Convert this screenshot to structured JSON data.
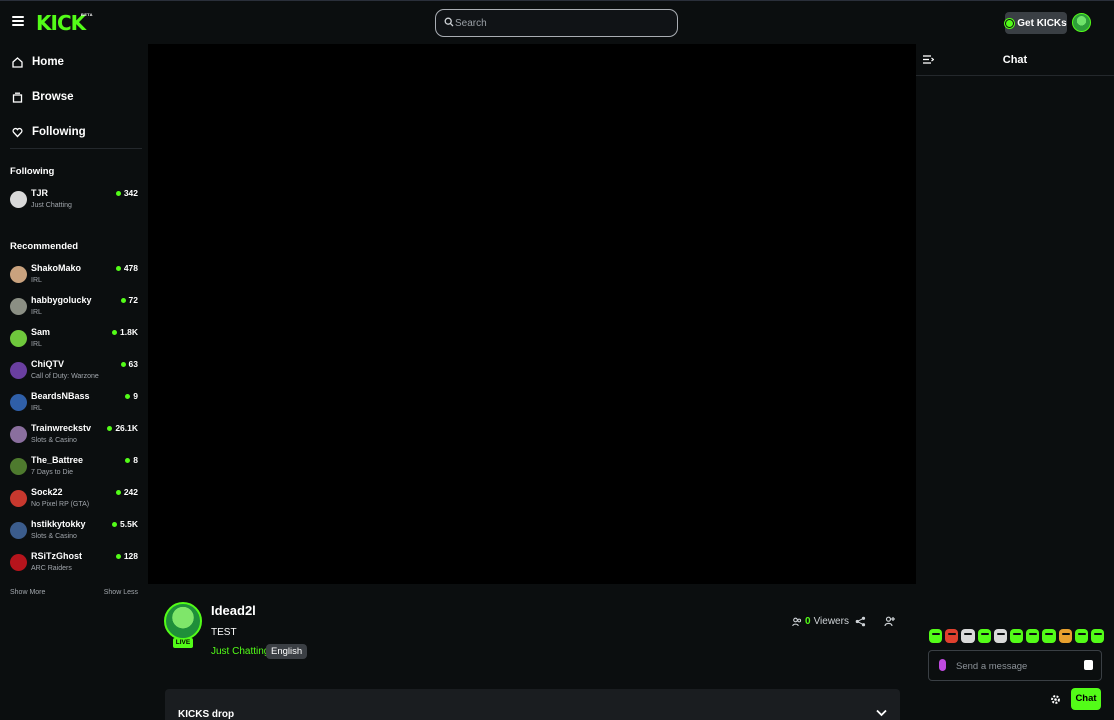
{
  "topbar": {
    "logo": "KICK",
    "beta": "BETA",
    "search_placeholder": "Search",
    "get_kicks_label": "Get KICKs"
  },
  "nav": {
    "home": "Home",
    "browse": "Browse",
    "following": "Following"
  },
  "sidebar": {
    "following_title": "Following",
    "following_channels": [
      {
        "name": "TJR",
        "category": "Just Chatting",
        "viewers": "342"
      }
    ],
    "recommended_title": "Recommended",
    "recommended_channels": [
      {
        "name": "ShakoMako",
        "category": "IRL",
        "viewers": "478"
      },
      {
        "name": "habbygolucky",
        "category": "IRL",
        "viewers": "72"
      },
      {
        "name": "Sam",
        "category": "IRL",
        "viewers": "1.8K"
      },
      {
        "name": "ChiQTV",
        "category": "Call of Duty: Warzone",
        "viewers": "63"
      },
      {
        "name": "BeardsNBass",
        "category": "IRL",
        "viewers": "9"
      },
      {
        "name": "Trainwreckstv",
        "category": "Slots & Casino",
        "viewers": "26.1K"
      },
      {
        "name": "The_Battree",
        "category": "7 Days to Die",
        "viewers": "8"
      },
      {
        "name": "Sock22",
        "category": "No Pixel RP (GTA)",
        "viewers": "242"
      },
      {
        "name": "hstikkytokky",
        "category": "Slots & Casino",
        "viewers": "5.5K"
      },
      {
        "name": "RSiTzGhost",
        "category": "ARC Raiders",
        "viewers": "128"
      }
    ],
    "show_more": "Show More",
    "show_less": "Show Less"
  },
  "stream": {
    "channel_name": "Idead2l",
    "title": "TEST",
    "category": "Just Chatting",
    "language": "English",
    "live_badge": "LIVE",
    "viewers_count": "0",
    "viewers_label": "Viewers",
    "kicks_drop_label": "KICKS drop"
  },
  "chat": {
    "title": "Chat",
    "input_placeholder": "Send a message",
    "send_label": "Chat"
  },
  "colors": {
    "accent": "#53fc18",
    "background": "#0b0e0f",
    "panel": "#1a1d20"
  }
}
